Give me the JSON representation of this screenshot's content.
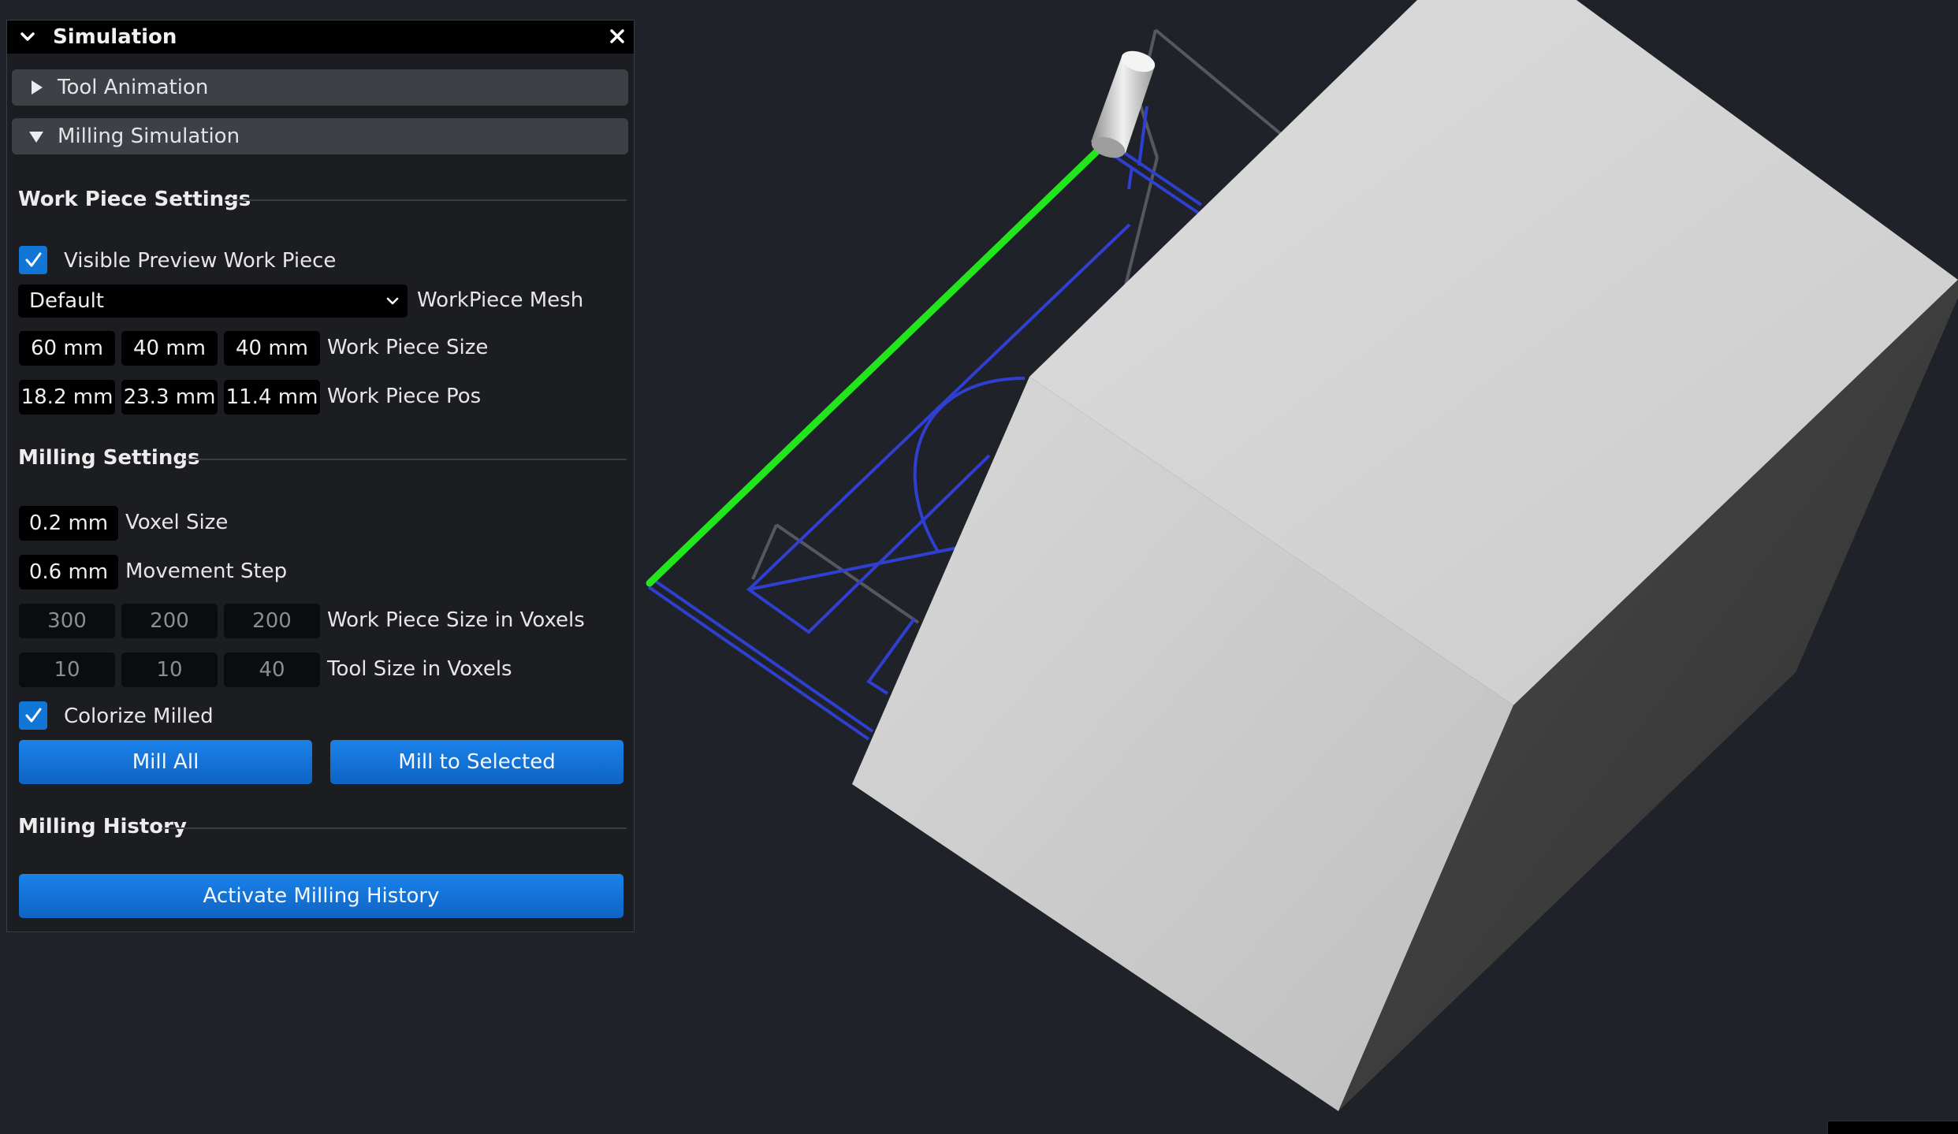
{
  "panel": {
    "title": "Simulation",
    "sections": {
      "tool_animation": "Tool Animation",
      "milling_simulation": "Milling Simulation"
    },
    "work_piece": {
      "heading": "Work Piece Settings",
      "visible_preview_label": "Visible Preview Work Piece",
      "visible_preview_checked": true,
      "mesh_value": "Default",
      "mesh_label": "WorkPiece Mesh",
      "size": [
        "60 mm",
        "40 mm",
        "40 mm"
      ],
      "size_label": "Work Piece Size",
      "pos": [
        "18.2 mm",
        "23.3 mm",
        "11.4 mm"
      ],
      "pos_label": "Work Piece Pos"
    },
    "milling": {
      "heading": "Milling Settings",
      "voxel_size": "0.2 mm",
      "voxel_size_label": "Voxel Size",
      "movement_step": "0.6 mm",
      "movement_step_label": "Movement Step",
      "voxels": [
        "300",
        "200",
        "200"
      ],
      "voxels_label": "Work Piece Size in Voxels",
      "tool_voxels": [
        "10",
        "10",
        "40"
      ],
      "tool_voxels_label": "Tool Size in Voxels",
      "colorize_label": "Colorize Milled",
      "colorize_checked": true,
      "mill_all": "Mill All",
      "mill_to_selected": "Mill to Selected"
    },
    "history": {
      "heading": "Milling History",
      "activate": "Activate Milling History"
    }
  },
  "scene": {
    "background": "#1f2228",
    "toolpath_color": "#2f3fd0",
    "active_path_color": "#22e61c",
    "workpiece_color": "#d4d4d4",
    "tool_name": "cylinder-tool"
  }
}
